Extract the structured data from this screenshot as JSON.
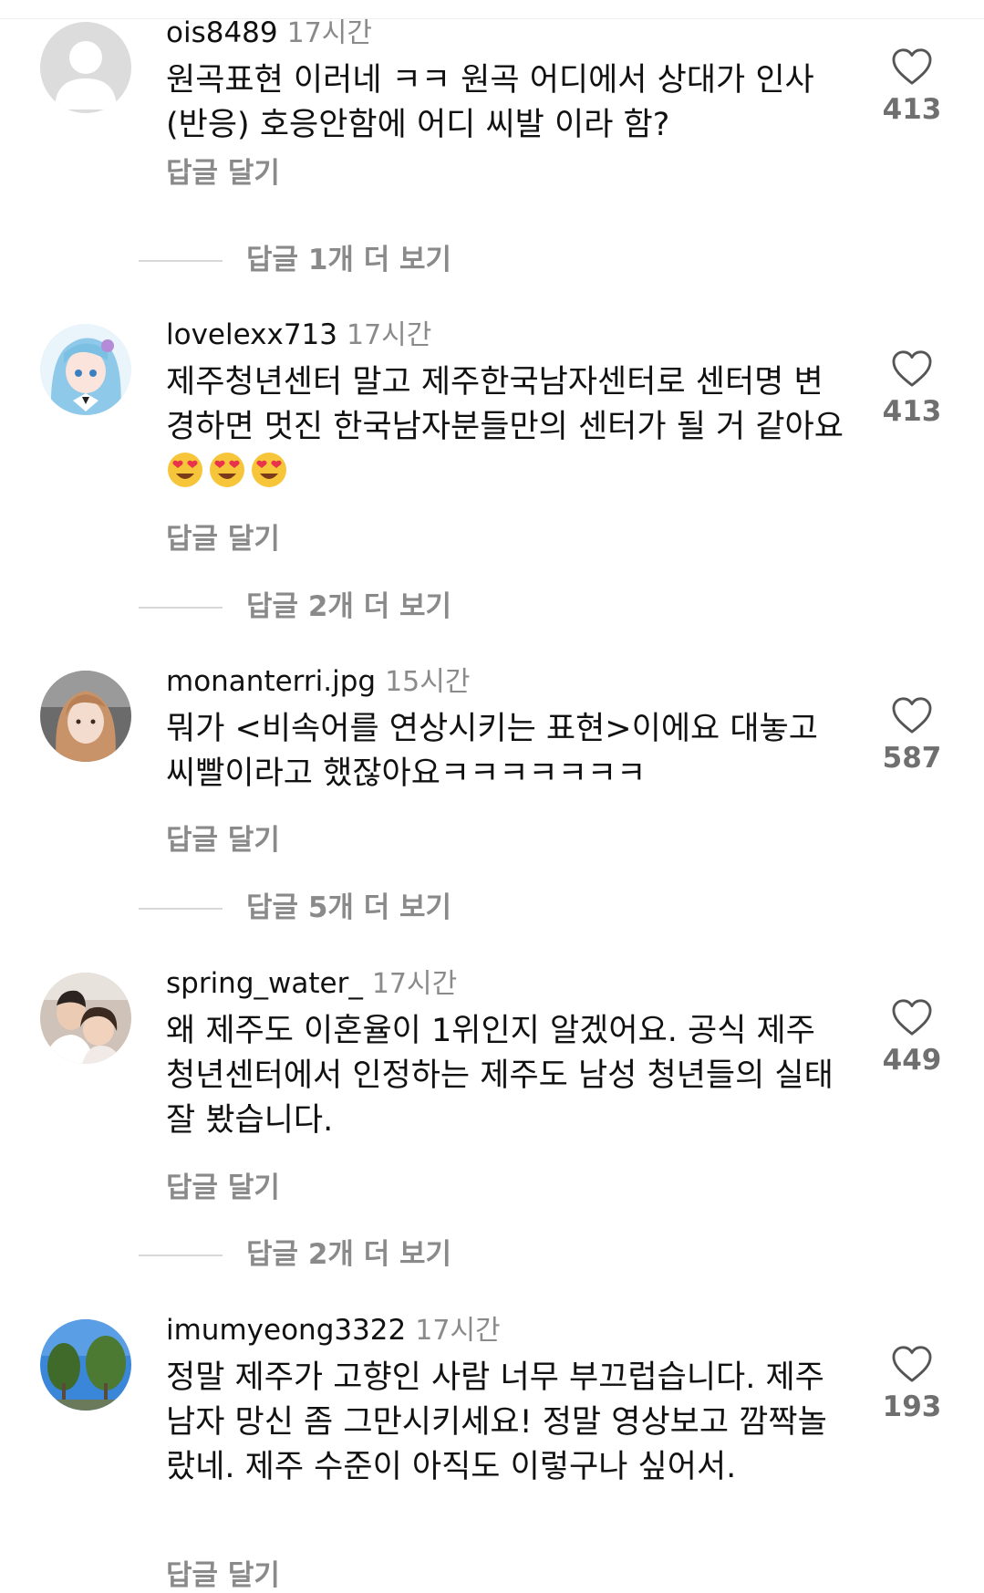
{
  "comments": [
    {
      "username": "ois8489",
      "time": "17시간",
      "text": "원곡표현 이러네 ㅋㅋ 원곡 어디에서 상대가 인사(반응) 호응안함에 어디 씨발 이라 함?",
      "emoji": "",
      "reply_label": "답글 달기",
      "likes": "413",
      "more_replies": "답글 1개 더 보기",
      "avatar_icon": "default-user-icon"
    },
    {
      "username": "lovelexx713",
      "time": "17시간",
      "text": "제주청년센터 말고 제주한국남자센터로 센터명 변경하면 멋진 한국남자분들만의 센터가 될 거 같아요",
      "emoji": "😍😍😍",
      "reply_label": "답글 달기",
      "likes": "413",
      "more_replies": "답글 2개 더 보기",
      "avatar_icon": "anime-avatar-icon"
    },
    {
      "username": "monanterri.jpg",
      "time": "15시간",
      "text": "뭐가 <비속어를 연상시키는 표현>이에요 대놓고 씨빨이라고 했잖아요ㅋㅋㅋㅋㅋㅋㅋ",
      "emoji": "",
      "reply_label": "답글 달기",
      "likes": "587",
      "more_replies": "답글 5개 더 보기",
      "avatar_icon": "photo-avatar-icon"
    },
    {
      "username": "spring_water_",
      "time": "17시간",
      "text": "왜 제주도 이혼율이 1위인지 알겠어요. 공식 제주 청년센터에서 인정하는 제주도 남성 청년들의 실태 잘 봤습니다.",
      "emoji": "",
      "reply_label": "답글 달기",
      "likes": "449",
      "more_replies": "답글 2개 더 보기",
      "avatar_icon": "couple-photo-avatar-icon"
    },
    {
      "username": "imumyeong3322",
      "time": "17시간",
      "text": "정말 제주가 고향인 사람 너무 부끄럽습니다. 제주남자 망신 좀 그만시키세요! 정말 영상보고 깜짝놀랐네. 제주 수준이 아직도 이렇구나 싶어서.",
      "emoji": "",
      "reply_label": "답글 달기",
      "likes": "193",
      "more_replies": "",
      "avatar_icon": "trees-photo-avatar-icon"
    }
  ],
  "colors": {
    "text": "#111111",
    "muted": "#8a8a8a",
    "divider": "#d8d8d8",
    "background": "#ffffff"
  }
}
